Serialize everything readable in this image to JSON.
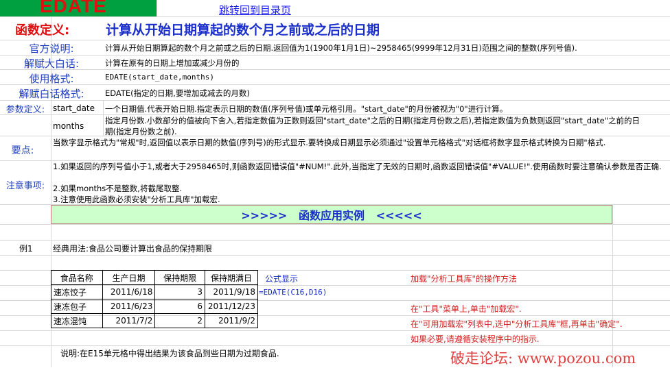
{
  "header": {
    "func_name": "EDATE",
    "back_link": "跳转回到目录页"
  },
  "definition": {
    "label": "函数定义:",
    "text": "计算从开始日期算起的数个月之前或之后的日期"
  },
  "rows": {
    "official_label": "官方说明:",
    "official_text": "计算从开始日期算起的数个月之前或之后的日期.返回值为1(1900年1月1日)~2958465(9999年12月31日)范围之间的整数(序列号值).",
    "plain_label": "解赋大白话:",
    "plain_text": "计算在原有的日期上增加或减少月份的",
    "usage_label": "使用格式:",
    "usage_text": "EDATE(start_date,months)",
    "plain_usage_label": "解赋白话格式:",
    "plain_usage_text": "EDATE(指定的日期,要增加或减去的月数)"
  },
  "params": {
    "label": "参数定义:",
    "items": [
      {
        "name": "start_date",
        "desc": "一个日期值.代表开始日期.指定表示日期的数值(序列号值)或单元格引用。\"start_date\"的月份被视为\"0\"进行计算。"
      },
      {
        "name": "months",
        "desc": "指定月份数.小数部分的值被向下舍入,若指定数值为正数则返回\"start_date\"之后的日期(指定月份数之后),若指定数值为负数则返回\"start_date\"之前的日期(指定月份数之前)."
      }
    ]
  },
  "key_points": {
    "label": "要点:",
    "text": "当数字显示格式为\"常规\"时,返回值以表示日期的数值(序列号)的形式显示.要转换成日期显示必须通过\"设置单元格格式\"对话框将数字显示格式转换为日期\"格式."
  },
  "notes": {
    "label": "注意事项:",
    "lines": [
      "1.如果返回的序列号值小于1,或者大于2958465时,则函数返回错误值\"#NUM!\".此外,当指定了无效的日期时,函数返回错误值\"#VALUE!\".使用函数时要注意确认参数是否正确.",
      "2.如果months不是整数,将截尾取整.",
      "3.注意使用此函数必须安装\"分析工具库\"加载宏."
    ]
  },
  "banner": {
    "text": ">>>>>   函数应用实例   <<<<<"
  },
  "example": {
    "label": "例1",
    "title": "经典用法:食品公司要计算出食品的保持期限",
    "headers": [
      "食品名称",
      "生产日期",
      "保持期限",
      "保持期满日"
    ],
    "rows": [
      [
        "速冻饺子",
        "2011/6/18",
        "3",
        "2011/9/18"
      ],
      [
        "速冻包子",
        "2011/6/23",
        "6",
        "2011/12/23"
      ],
      [
        "速冻混饨",
        "2011/7/2",
        "2",
        "2011/9/2"
      ]
    ],
    "formula_header": "公式显示",
    "formula": "=EDATE(C16,D16)",
    "note": "说明:在E15单元格中得出结果为该食品到些日期为过期食品."
  },
  "addin": {
    "title": "加载\"分析工具库\"的操作方法",
    "steps": [
      "在\"工具\"菜单上,单击\"加载宏\".",
      "在\"可用加载宏\"列表中,选中\"分析工具库\"框,再单击\"确定\".",
      "如果必要,请遵循安装程序中的指示."
    ]
  },
  "watermark": "破走论坛: www.pozou.com",
  "colors": {
    "header_bg": "#00a040",
    "title_red": "#e01010",
    "label_blue": "#1f3fbf",
    "banner_bg": "#ccffcc",
    "banner_text": "#1a2ecc"
  }
}
